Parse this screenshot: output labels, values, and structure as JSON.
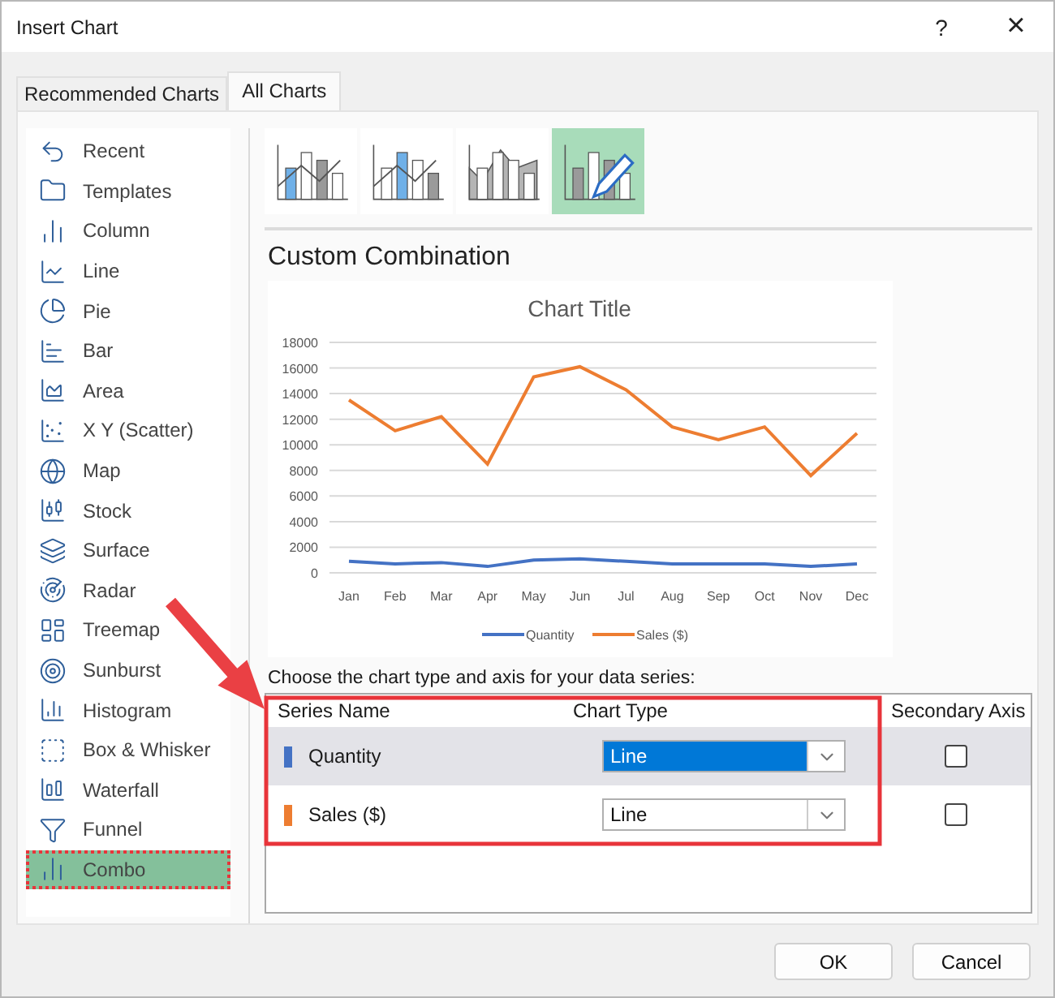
{
  "window": {
    "title": "Insert Chart",
    "help": "?",
    "close": "×"
  },
  "tabs": [
    {
      "label": "Recommended Charts",
      "selected": false
    },
    {
      "label": "All Charts",
      "selected": true
    }
  ],
  "sidebar": {
    "items": [
      {
        "label": "Recent",
        "selected": false
      },
      {
        "label": "Templates",
        "selected": false
      },
      {
        "label": "Column",
        "selected": false
      },
      {
        "label": "Line",
        "selected": false
      },
      {
        "label": "Pie",
        "selected": false
      },
      {
        "label": "Bar",
        "selected": false
      },
      {
        "label": "Area",
        "selected": false
      },
      {
        "label": "X Y (Scatter)",
        "selected": false
      },
      {
        "label": "Map",
        "selected": false
      },
      {
        "label": "Stock",
        "selected": false
      },
      {
        "label": "Surface",
        "selected": false
      },
      {
        "label": "Radar",
        "selected": false
      },
      {
        "label": "Treemap",
        "selected": false
      },
      {
        "label": "Sunburst",
        "selected": false
      },
      {
        "label": "Histogram",
        "selected": false
      },
      {
        "label": "Box & Whisker",
        "selected": false
      },
      {
        "label": "Waterfall",
        "selected": false
      },
      {
        "label": "Funnel",
        "selected": false
      },
      {
        "label": "Combo",
        "selected": true
      }
    ]
  },
  "subtypes": [
    {
      "selected": false
    },
    {
      "selected": false
    },
    {
      "selected": false
    },
    {
      "selected": true
    }
  ],
  "heading": "Custom Combination",
  "chart": {
    "chart_data": {
      "type": "line",
      "title": "Chart Title",
      "categories": [
        "Jan",
        "Feb",
        "Mar",
        "Apr",
        "May",
        "Jun",
        "Jul",
        "Aug",
        "Sep",
        "Oct",
        "Nov",
        "Dec"
      ],
      "series": [
        {
          "name": "Quantity",
          "color": "#4472c4",
          "values": [
            900,
            700,
            800,
            500,
            1000,
            1100,
            900,
            700,
            700,
            700,
            500,
            700
          ]
        },
        {
          "name": "Sales ($)",
          "color": "#ed7d31",
          "values": [
            13500,
            11100,
            12200,
            8500,
            15300,
            16100,
            14300,
            11400,
            10400,
            11400,
            7600,
            10900
          ]
        }
      ],
      "grid": true,
      "legend": true,
      "ylim": [
        0,
        18000
      ],
      "yticks": [
        0,
        2000,
        4000,
        6000,
        8000,
        10000,
        12000,
        14000,
        16000,
        18000
      ]
    }
  },
  "series_prompt": "Choose the chart type and axis for your data series:",
  "series_table": {
    "columns": [
      "Series Name",
      "Chart Type",
      "Secondary Axis"
    ],
    "rows": [
      {
        "name": "Quantity",
        "color": "#4472c4",
        "chart_type": "Line",
        "selected": true,
        "secondary_axis": false
      },
      {
        "name": "Sales ($)",
        "color": "#ed7d31",
        "chart_type": "Line",
        "selected": false,
        "secondary_axis": false
      }
    ]
  },
  "buttons": [
    "OK",
    "Cancel"
  ]
}
